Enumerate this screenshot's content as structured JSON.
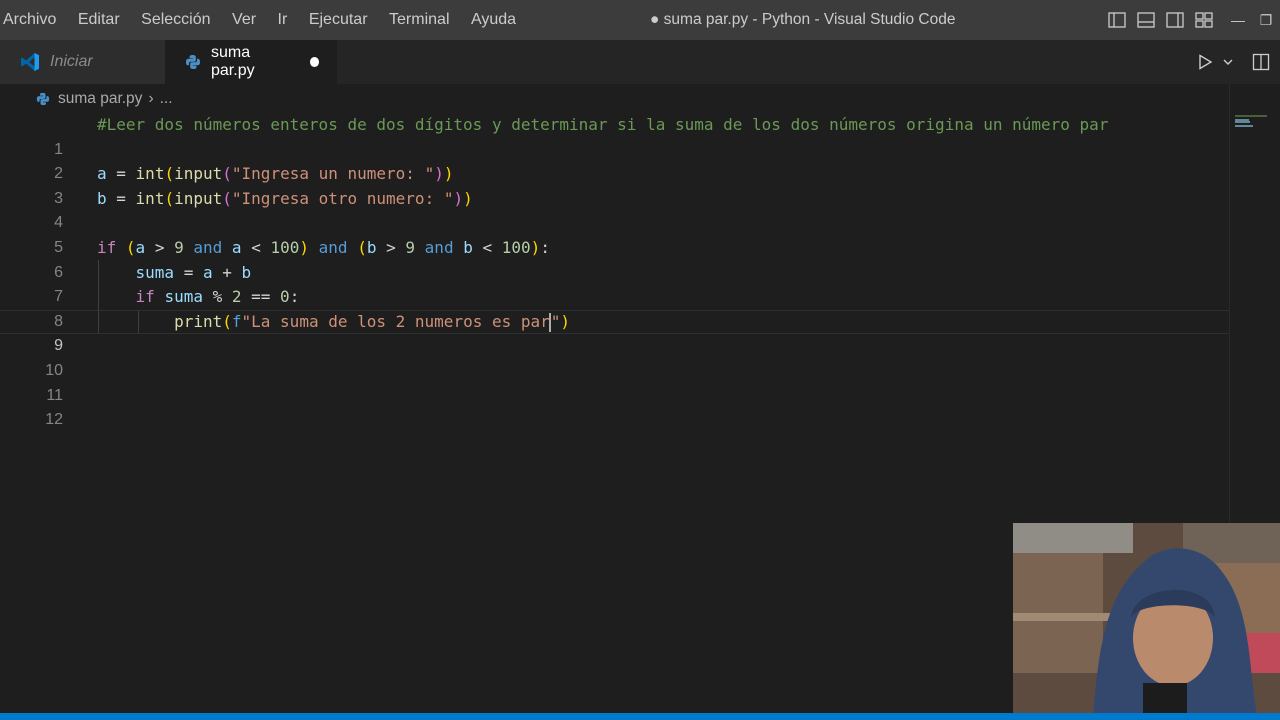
{
  "menu": {
    "items": [
      "Archivo",
      "Editar",
      "Selección",
      "Ver",
      "Ir",
      "Ejecutar",
      "Terminal",
      "Ayuda"
    ]
  },
  "window": {
    "title": "● suma par.py - Python - Visual Studio Code",
    "minimize": "—",
    "restore": "❐"
  },
  "tabs": [
    {
      "label": "Iniciar",
      "active": false,
      "icon": "vscode-logo-icon"
    },
    {
      "label": "suma par.py",
      "active": true,
      "dirty": true,
      "icon": "python-file-icon"
    }
  ],
  "breadcrumb": {
    "file": "suma par.py",
    "separator": "›",
    "rest": "..."
  },
  "editor": {
    "current_line": 9,
    "lines": [
      {
        "n": "1"
      },
      {
        "n": "2"
      },
      {
        "n": "3"
      },
      {
        "n": "4"
      },
      {
        "n": "5"
      },
      {
        "n": "6"
      },
      {
        "n": "7"
      },
      {
        "n": "8"
      },
      {
        "n": "9"
      },
      {
        "n": "10"
      },
      {
        "n": "11"
      },
      {
        "n": "12"
      }
    ],
    "code": {
      "l1": "#Leer dos números enteros de dos dígitos y determinar si la suma de los dos números origina un número par",
      "l3_var": "a",
      "l3_eq": " = ",
      "l3_int": "int",
      "l3_input": "input",
      "l3_str": "\"Ingresa un numero: \"",
      "l4_var": "b",
      "l4_str": "\"Ingresa otro numero: \"",
      "l6_if": "if",
      "l6_and": "and",
      "l6_n9": "9",
      "l6_n100": "100",
      "l7_suma": "suma",
      "l8_if": "if",
      "l8_n2": "2",
      "l8_n0": "0",
      "l9_print": "print",
      "l9_f": "f",
      "l9_str": "\"La suma de los 2 numeros es par",
      "l9_close": "\""
    }
  },
  "colors": {
    "accent": "#007acc",
    "editor_bg": "#1e1e1e",
    "titlebar_bg": "#3c3c3c"
  }
}
